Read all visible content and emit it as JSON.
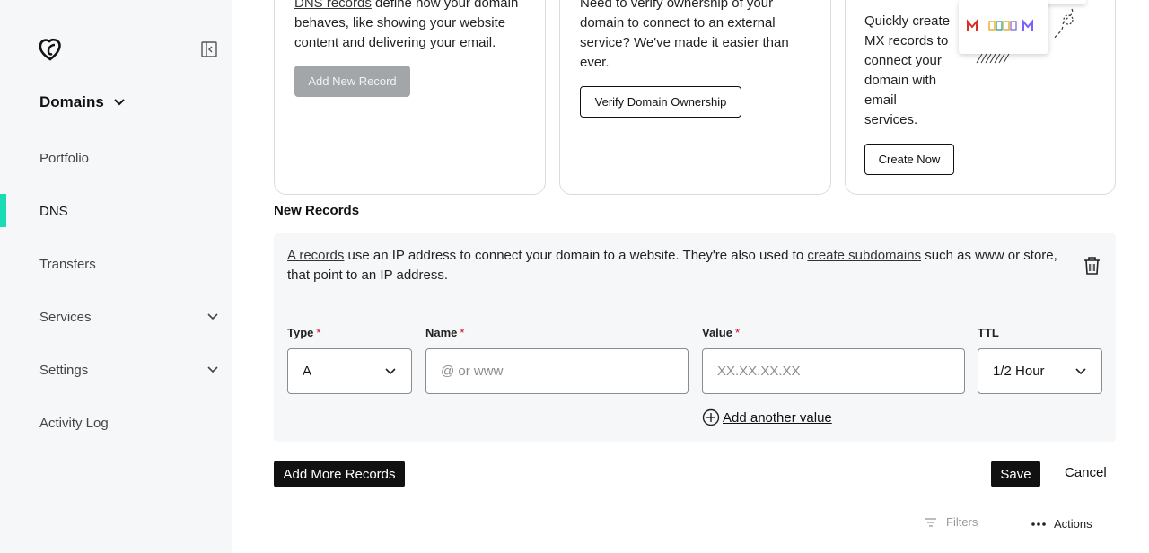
{
  "sidebar": {
    "section_title": "Domains",
    "items": [
      {
        "label": "Portfolio"
      },
      {
        "label": "DNS",
        "active": true
      },
      {
        "label": "Transfers"
      },
      {
        "label": "Services",
        "expandable": true
      },
      {
        "label": "Settings",
        "expandable": true
      },
      {
        "label": "Activity Log"
      }
    ]
  },
  "cards": {
    "dns_records": {
      "link": "DNS records",
      "text_line1": " define how your domain",
      "text_line2": "behaves, like showing your website",
      "text_line3": "content and delivering your email.",
      "button": "Add New Record"
    },
    "verify": {
      "line1": "Need to verify ownership of your",
      "line2": "domain to connect to an external",
      "line3": "service? We've made it easier than",
      "line4": "ever.",
      "button": "Verify Domain Ownership"
    },
    "mx": {
      "line1": "Quickly create",
      "line2": "MX records to",
      "line3": "connect your",
      "line4": "domain with",
      "line5": "email",
      "line6": "services.",
      "button": "Create Now"
    }
  },
  "new_records": {
    "title": "New Records",
    "desc_link1": "A records",
    "desc_mid": " use an IP address to connect your domain to a website. They're also used to ",
    "desc_link2": "create subdomains",
    "desc_end": " such as www or store, that point to an IP address.",
    "fields": {
      "type_label": "Type",
      "type_value": "A",
      "name_label": "Name",
      "name_placeholder": "@ or www",
      "value_label": "Value",
      "value_placeholder": "XX.XX.XX.XX",
      "ttl_label": "TTL",
      "ttl_value": "1/2 Hour",
      "required_mark": "*"
    },
    "add_value": "Add another value"
  },
  "footer": {
    "add_more": "Add More Records",
    "save": "Save",
    "cancel": "Cancel",
    "filters": "Filters",
    "actions": "Actions"
  },
  "colors": {
    "accent": "#1bdbb5",
    "sidebar_bg": "#f5f7f8",
    "dark_button": "#111111",
    "required": "#d0021b"
  }
}
